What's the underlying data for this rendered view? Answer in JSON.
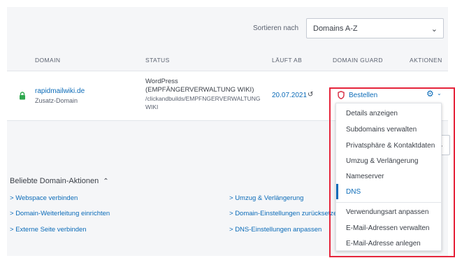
{
  "sort": {
    "label": "Sortieren nach",
    "selected": "Domains A-Z"
  },
  "table": {
    "headers": {
      "domain": "DOMAIN",
      "status": "STATUS",
      "expires": "LÄUFT AB",
      "guard": "DOMAIN GUARD",
      "actions": "AKTIONEN"
    },
    "row": {
      "domain": "rapidmailwiki.de",
      "domain_type": "Zusatz-Domain",
      "status_lines": [
        "WordPress",
        "(EMPFÄNGERVERWALTUNG WIKI)"
      ],
      "status_path_lines": [
        "/clickandbuilds/EMPFNGERVERWALTUNG",
        "WIKI"
      ],
      "expires": "20.07.2021",
      "guard_action": "Bestellen"
    }
  },
  "popular": {
    "title": "Beliebte Domain-Aktionen",
    "links": [
      "Webspace verbinden",
      "Domain-Weiterleitung einrichten",
      "Externe Seite verbinden",
      "Umzug & Verlängerung",
      "Domain-Einstellungen zurücksetzen",
      "DNS-Einstellungen anpassen"
    ]
  },
  "dropdown": {
    "items": [
      "Details anzeigen",
      "Subdomains verwalten",
      "Privatsphäre & Kontaktdaten",
      "Umzug & Verlängerung",
      "Nameserver",
      "DNS",
      "Verwendungsart anpassen",
      "E-Mail-Adressen verwalten",
      "E-Mail-Adresse anlegen"
    ],
    "active_item": "DNS"
  },
  "icons": {
    "lock": "lock-icon",
    "refresh": "refresh-icon",
    "shield": "shield-icon",
    "gear": "gear-icon",
    "chevron": "chevron-down-icon"
  },
  "colors": {
    "link": "#0b6bb8",
    "lock": "#2fa84f",
    "shield": "#d6283f",
    "highlight": "#e5243b"
  }
}
